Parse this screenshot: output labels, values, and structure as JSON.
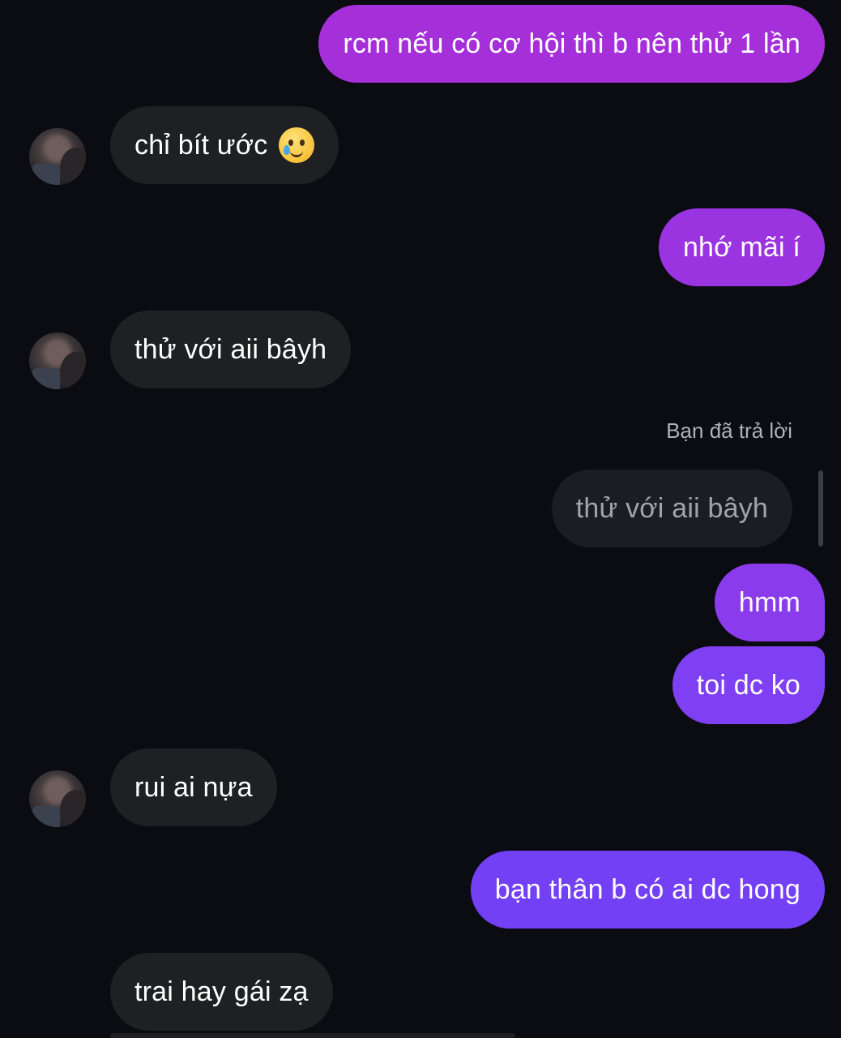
{
  "chat": {
    "messages": [
      {
        "sender": "me",
        "text": "rcm nếu có cơ hội thì b nên thử 1 lần",
        "bubble_color": "#a52fd9"
      },
      {
        "sender": "other",
        "text": "chỉ bít ước",
        "emoji": "face-holding-back-tears-icon"
      },
      {
        "sender": "me",
        "text": "nhớ mãi í",
        "bubble_color": "#9a33e0"
      },
      {
        "sender": "other",
        "text": "thử với aii bâyh"
      },
      {
        "sender": "me",
        "text": "hmm",
        "bubble_color": "#8a3bec"
      },
      {
        "sender": "me",
        "text": "toi dc ko",
        "bubble_color": "#7f3ff2"
      },
      {
        "sender": "other",
        "text": "rui ai nựa"
      },
      {
        "sender": "me",
        "text": "bạn thân b có ai dc hong",
        "bubble_color": "#7440f5"
      },
      {
        "sender": "other",
        "text": "trai hay gái zạ"
      }
    ],
    "reply": {
      "label": "Bạn đã trả lời",
      "quoted_text": "thử với aii bâyh"
    }
  },
  "colors": {
    "background": "#0b0b12",
    "incoming_bubble": "#1f2024",
    "outgoing_gradient_top": "#a82ed8",
    "outgoing_gradient_bottom": "#7440f5"
  }
}
